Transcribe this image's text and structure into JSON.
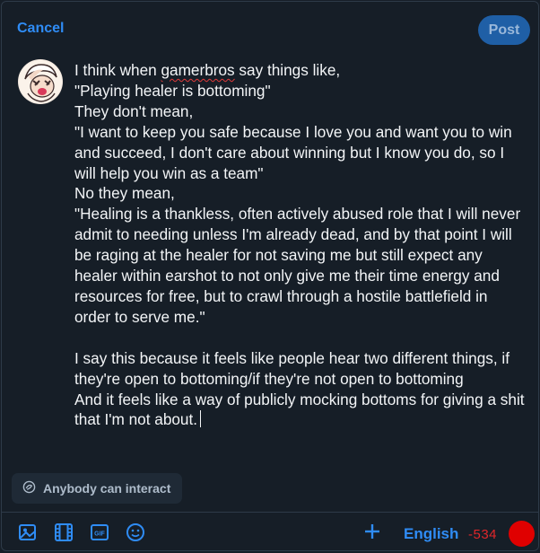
{
  "header": {
    "cancel_label": "Cancel",
    "post_label": "Post"
  },
  "composer": {
    "line_1_prefix": "I think when ",
    "misspelled_word": "gamerbros",
    "line_1_suffix": " say things like,",
    "body": "\"Playing healer is bottoming\"\nThey don't mean,\n\"I want to keep you safe because I love you and want you to win and succeed, I don't care about winning but I know you do, so I will help you win as a team\"\nNo they mean,\n\"Healing is a thankless, often actively abused role that I will never admit to needing unless I'm already dead, and by that point I will be raging at the healer for not saving me but still expect any healer within earshot to not only give me their time energy and resources for free, but to crawl through a hostile battlefield in order to serve me.\"\n\nI say this because it feels like people hear two different things, if they're open to bottoming/if they're not open to bottoming\nAnd it feels like a way of publicly mocking bottoms for giving a shit that I'm not about."
  },
  "interaction_setting": {
    "label": "Anybody can interact",
    "icon": "globe-chat-icon"
  },
  "toolbar": {
    "icons": [
      "image-icon",
      "video-icon",
      "gif-icon",
      "emoji-icon"
    ],
    "language_label": "English",
    "char_remaining": "-534",
    "accent_color": "#2f8cf5",
    "over_limit_color": "#e00000"
  }
}
